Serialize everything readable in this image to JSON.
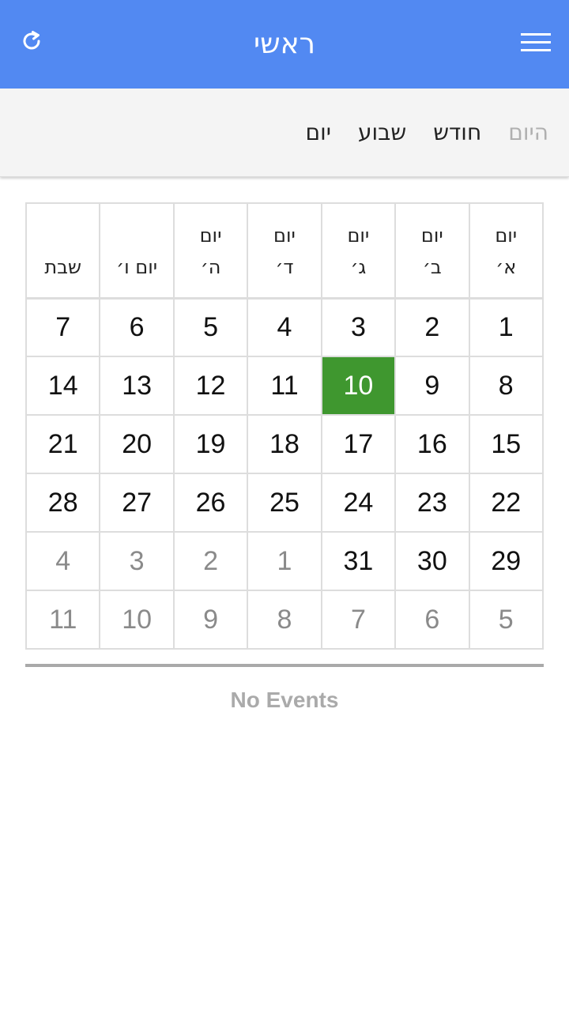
{
  "header": {
    "title": "ראשי",
    "refresh_icon": "refresh-icon",
    "menu_icon": "hamburger-menu-icon",
    "background_color": "#5289f2"
  },
  "views": {
    "day": "יום",
    "week": "שבוע",
    "month": "חודש",
    "today": "היום"
  },
  "calendar": {
    "weekdays": [
      {
        "line1": "יום",
        "line2": "א׳"
      },
      {
        "line1": "יום",
        "line2": "ב׳"
      },
      {
        "line1": "יום",
        "line2": "ג׳"
      },
      {
        "line1": "יום",
        "line2": "ד׳"
      },
      {
        "line1": "יום",
        "line2": "ה׳"
      },
      {
        "line1": "",
        "line2": "יום ו׳"
      },
      {
        "line1": "",
        "line2": "שבת"
      }
    ],
    "weeks": [
      [
        {
          "d": "1"
        },
        {
          "d": "2"
        },
        {
          "d": "3"
        },
        {
          "d": "4"
        },
        {
          "d": "5"
        },
        {
          "d": "6"
        },
        {
          "d": "7"
        }
      ],
      [
        {
          "d": "8"
        },
        {
          "d": "9"
        },
        {
          "d": "10",
          "today": true
        },
        {
          "d": "11"
        },
        {
          "d": "12"
        },
        {
          "d": "13"
        },
        {
          "d": "14"
        }
      ],
      [
        {
          "d": "15"
        },
        {
          "d": "16"
        },
        {
          "d": "17"
        },
        {
          "d": "18"
        },
        {
          "d": "19"
        },
        {
          "d": "20"
        },
        {
          "d": "21"
        }
      ],
      [
        {
          "d": "22"
        },
        {
          "d": "23"
        },
        {
          "d": "24"
        },
        {
          "d": "25"
        },
        {
          "d": "26"
        },
        {
          "d": "27"
        },
        {
          "d": "28"
        }
      ],
      [
        {
          "d": "29"
        },
        {
          "d": "30"
        },
        {
          "d": "31"
        },
        {
          "d": "1",
          "other": true
        },
        {
          "d": "2",
          "other": true
        },
        {
          "d": "3",
          "other": true
        },
        {
          "d": "4",
          "other": true
        }
      ],
      [
        {
          "d": "5",
          "other": true
        },
        {
          "d": "6",
          "other": true
        },
        {
          "d": "7",
          "other": true
        },
        {
          "d": "8",
          "other": true
        },
        {
          "d": "9",
          "other": true
        },
        {
          "d": "10",
          "other": true
        },
        {
          "d": "11",
          "other": true
        }
      ]
    ],
    "today_color": "#3f972f"
  },
  "events": {
    "empty_text": "No Events"
  }
}
